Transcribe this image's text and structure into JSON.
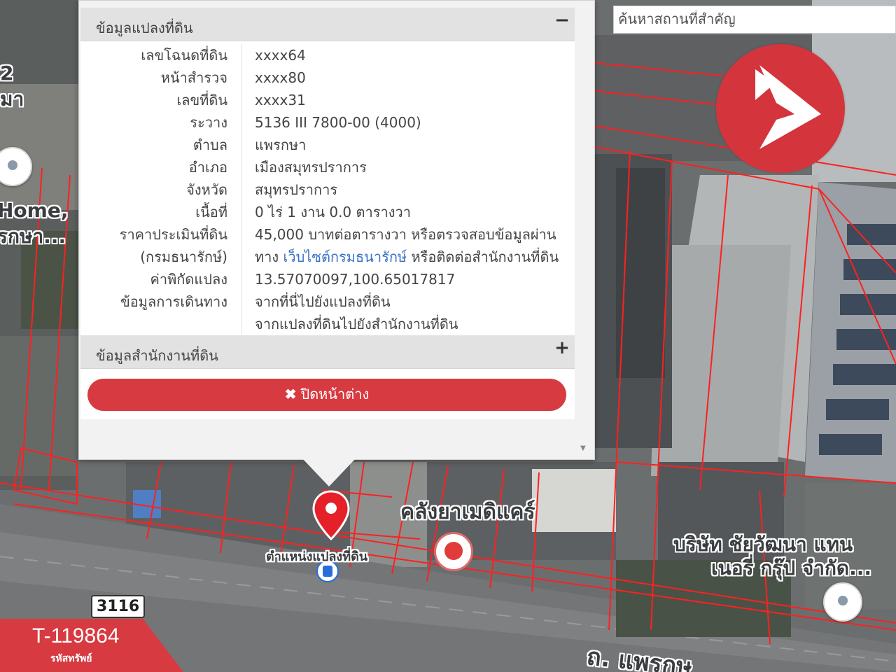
{
  "search": {
    "placeholder": "ค้นหาสถานที่สำคัญ"
  },
  "popup": {
    "section_parcel": {
      "title": "ข้อมูลแปลงที่ดิน",
      "toggle": "−"
    },
    "rows": [
      {
        "label": "เลขโฉนดที่ดิน",
        "value": "xxxx64"
      },
      {
        "label": "หน้าสำรวจ",
        "value": "xxxx80"
      },
      {
        "label": "เลขที่ดิน",
        "value": "xxxx31"
      },
      {
        "label": "ระวาง",
        "value": "5136 III 7800-00 (4000)"
      },
      {
        "label": "ตำบล",
        "value": "แพรกษา"
      },
      {
        "label": "อำเภอ",
        "value": "เมืองสมุทรปราการ"
      },
      {
        "label": "จังหวัด",
        "value": "สมุทรปราการ"
      },
      {
        "label": "เนื้อที่",
        "value": "0 ไร่ 1 งาน 0.0 ตารางวา"
      }
    ],
    "price": {
      "label_line1": "ราคาประเมินที่ดิน",
      "label_line2": "(กรมธนารักษ์)",
      "value_line1": "45,000 บาทต่อตารางวา หรือตรวจสอบข้อมูลผ่าน",
      "value_prefix": "ทาง",
      "value_link": "เว็บไซต์กรมธนารักษ์",
      "value_suffix": "หรือติดต่อสำนักงานที่ดิน"
    },
    "coords": {
      "label": "ค่าพิกัดแปลง",
      "value": "13.57070097,100.65017817"
    },
    "travel": {
      "label": "ข้อมูลการเดินทาง",
      "link1": "จากที่นี่ไปยังแปลงที่ดิน",
      "link2": "จากแปลงที่ดินไปยังสำนักงานที่ดิน"
    },
    "section_office": {
      "title": "ข้อมูลสำนักงานที่ดิน",
      "toggle": "+"
    },
    "close_button": {
      "icon": "✖",
      "label": "ปิดหน้าต่าง"
    }
  },
  "map": {
    "labels": {
      "pin_label": "ตำแหน่งแปลงที่ดิน",
      "warehouse": "คลังยาเมดิแคร์",
      "company_line1": "บริษัท ชัยวัฒนา แทน",
      "company_line2": "เนอรี่ กรุ๊ป จำกัด...",
      "road": "ถ. แพรกษ",
      "route": "3116",
      "home_line1": "Home,",
      "home_line2": "รกษา...",
      "left_fragment1": "2",
      "left_fragment2": "มา"
    }
  },
  "badge": {
    "code": "T-119864",
    "label": "รหัสทรัพย์"
  },
  "colors": {
    "accent": "#d73a40",
    "link": "#3a72c4",
    "parcel_line": "#ff2020"
  }
}
